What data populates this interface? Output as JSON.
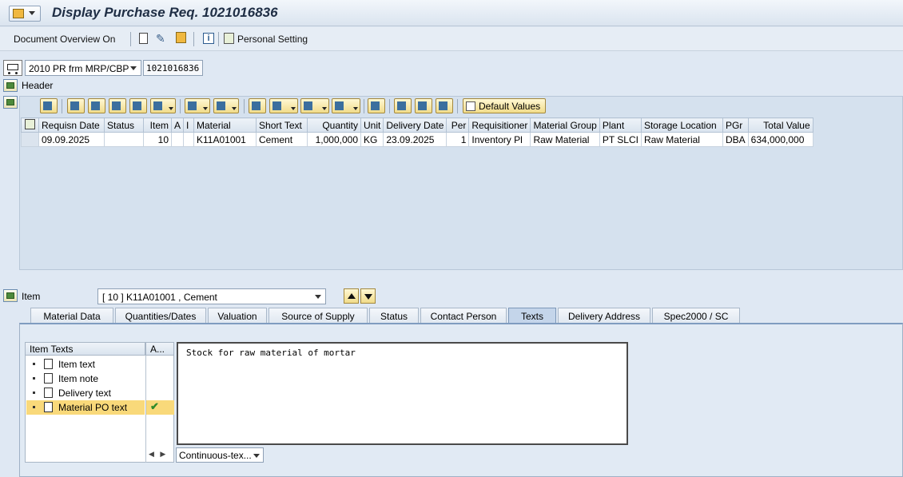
{
  "window": {
    "title": "Display Purchase Req. 1021016836"
  },
  "toolbar": {
    "doc_overview": "Document Overview On",
    "personal_setting": "Personal Setting"
  },
  "document": {
    "type": "2010 PR frm MRP/CBP",
    "number": "1021016836"
  },
  "sections": {
    "header": "Header",
    "item": "Item"
  },
  "grid_toolbar": {
    "default_values": "Default Values"
  },
  "grid": {
    "columns": [
      "Requisn Date",
      "Status",
      "Item",
      "A",
      "I",
      "Material",
      "Short Text",
      "Quantity",
      "Unit",
      "Delivery Date",
      "Per",
      "Requisitioner",
      "Material Group",
      "Plant",
      "Storage Location",
      "PGr",
      "Total Value"
    ],
    "rows": [
      [
        "09.09.2025",
        "",
        "10",
        "",
        "",
        "K11A01001",
        "Cement",
        "1,000,000",
        "KG",
        "23.09.2025",
        "1",
        "Inventory Pl",
        "Raw Material",
        "PT SLCI",
        "Raw Material",
        "DBA",
        "634,000,000"
      ]
    ]
  },
  "item_selector": {
    "value": "[ 10 ] K11A01001 , Cement"
  },
  "tabs": [
    "Material Data",
    "Quantities/Dates",
    "Valuation",
    "Source of Supply",
    "Status",
    "Contact Person",
    "Texts",
    "Delivery Address",
    "Spec2000 / SC"
  ],
  "active_tab": "Texts",
  "item_texts": {
    "header": "Item Texts",
    "col2": "A...",
    "items": [
      "Item text",
      "Item note",
      "Delivery text",
      "Material PO text"
    ],
    "selected": "Material PO text"
  },
  "text_content": "Stock for raw material of mortar",
  "format": "Continuous-tex..."
}
